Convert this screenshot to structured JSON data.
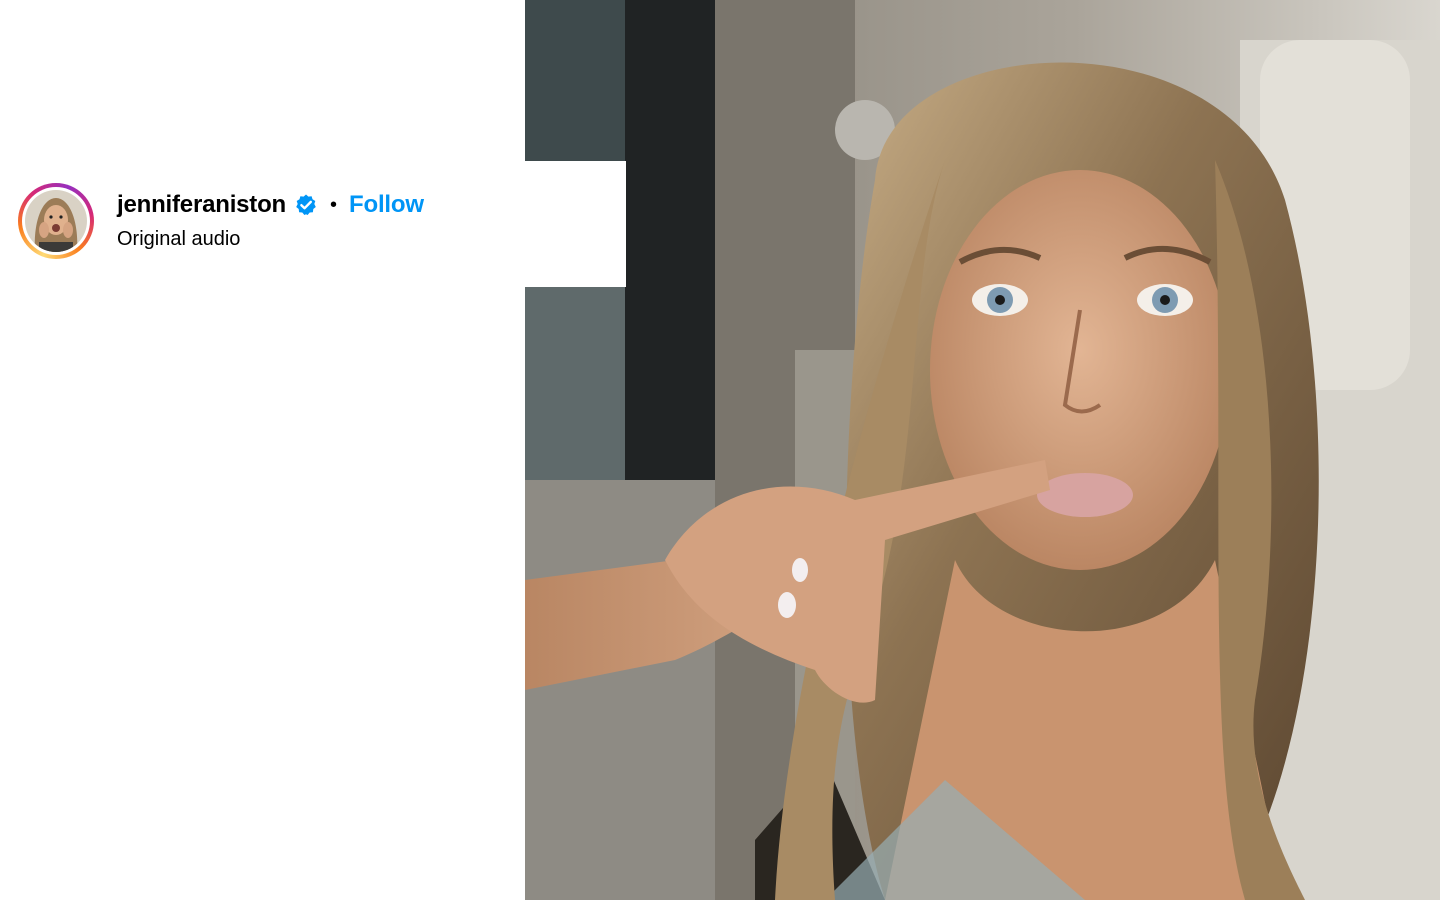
{
  "post": {
    "author": {
      "username": "jenniferaniston",
      "verified": true,
      "verified_icon": "verified-badge-icon",
      "separator": "•",
      "follow_label": "Follow",
      "avatar_icon": "profile-avatar"
    },
    "audio_label": "Original audio",
    "media": {
      "type": "photo"
    }
  },
  "colors": {
    "follow_blue": "#0095f6",
    "verified_blue": "#0095f6",
    "text": "#000000",
    "background": "#ffffff"
  }
}
